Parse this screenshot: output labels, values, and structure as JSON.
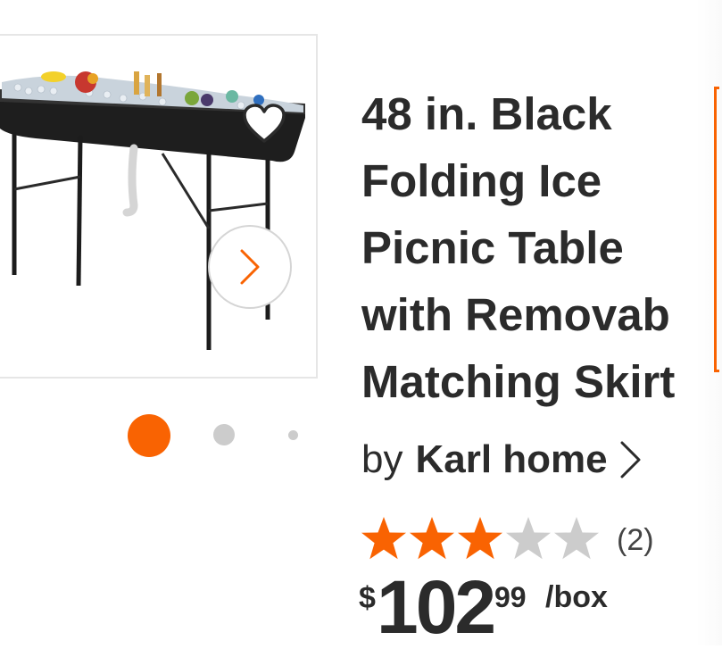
{
  "product": {
    "title_lines": [
      "48 in. Black",
      "Folding Ice",
      "Picnic Table",
      "with Removab",
      "Matching Skirt"
    ],
    "brand_prefix": "by",
    "brand_name": "Karl home",
    "rating": 3,
    "rating_max": 5,
    "review_count": "(2)",
    "price": {
      "currency": "$",
      "dollars": "102",
      "cents": "99",
      "unit": "/box"
    }
  },
  "gallery": {
    "image_count": 3,
    "active_index": 0,
    "icons": {
      "favorite": "heart-icon",
      "next": "chevron-right-icon"
    }
  },
  "colors": {
    "accent": "#f96302",
    "star_filled": "#f96302",
    "star_empty": "#cccccc",
    "text": "#2b2b2b"
  }
}
